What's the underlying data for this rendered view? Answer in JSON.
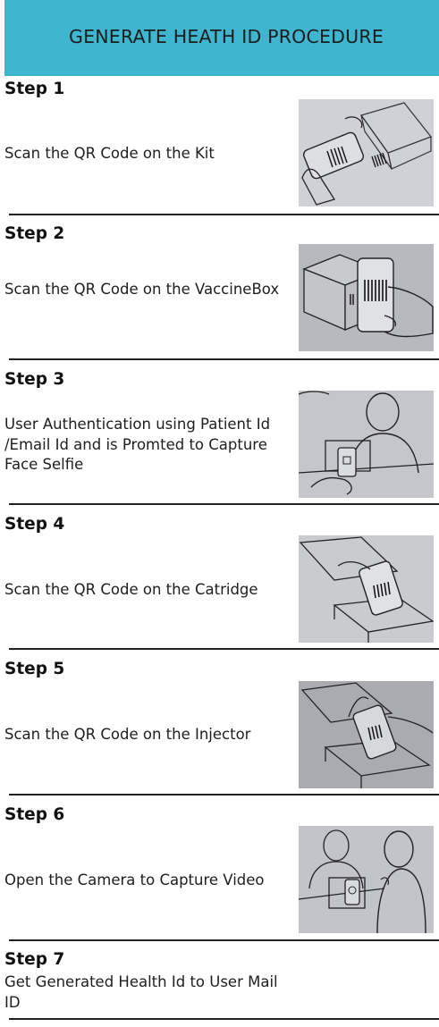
{
  "header": {
    "title": "GENERATE HEATH ID PROCEDURE",
    "background": "#3fb6d0"
  },
  "steps": [
    {
      "title": "Step 1",
      "description": "Scan the QR Code on the Kit"
    },
    {
      "title": "Step 2",
      "description": "Scan the QR Code on the VaccineBox"
    },
    {
      "title": "Step 3",
      "description": "User Authentication using Patient Id /Email Id and is Promted to Capture Face Selfie"
    },
    {
      "title": "Step 4",
      "description": "Scan the QR Code on the Catridge"
    },
    {
      "title": "Step 5",
      "description": "Scan the QR Code on the Injector"
    },
    {
      "title": "Step 6",
      "description": "Open the Camera to Capture Video"
    },
    {
      "title": "Step 7",
      "description": "Get Generated Health Id to User Mail ID"
    }
  ]
}
